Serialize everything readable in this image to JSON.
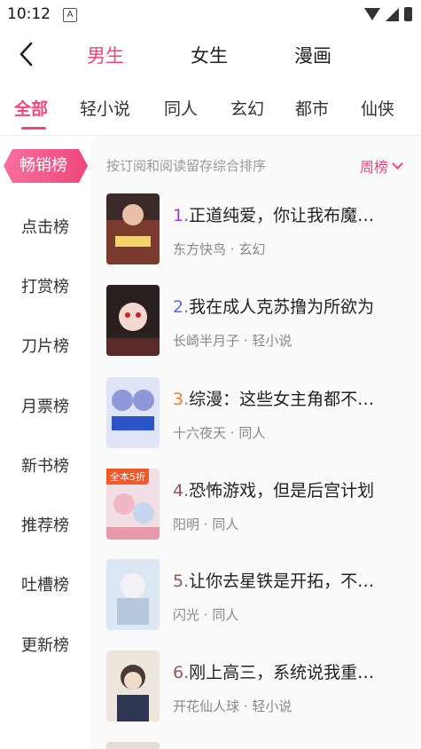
{
  "status": {
    "time": "10:12",
    "notif_icon": "A"
  },
  "header": {
    "back_icon": "back-arrow-icon",
    "tabs": [
      {
        "label": "男生",
        "active": true
      },
      {
        "label": "女生",
        "active": false
      },
      {
        "label": "漫画",
        "active": false
      }
    ]
  },
  "categories": [
    "全部",
    "轻小说",
    "同人",
    "玄幻",
    "都市",
    "仙侠"
  ],
  "sidebar": [
    "畅销榜",
    "点击榜",
    "打赏榜",
    "刀片榜",
    "月票榜",
    "新书榜",
    "推荐榜",
    "吐槽榜",
    "更新榜"
  ],
  "sort": {
    "description": "按订阅和阅读留存综合排序",
    "period": "周榜"
  },
  "books": [
    {
      "rank": "1.",
      "title": "正道纯爱，你让我布魔…",
      "author": "东方快鸟",
      "genre": "玄幻",
      "rank_color": "#9b3fd6"
    },
    {
      "rank": "2.",
      "title": "我在成人克苏撸为所欲为",
      "author": "长崎半月子",
      "genre": "轻小说",
      "rank_color": "#5b6ad8"
    },
    {
      "rank": "3.",
      "title": "综漫：这些女主角都不…",
      "author": "十六夜天",
      "genre": "同人",
      "rank_color": "#f07a28"
    },
    {
      "rank": "4.",
      "title": "恐怖游戏，但是后宫计划",
      "author": "阳明",
      "genre": "同人",
      "rank_color": "#8b5a5a",
      "badge": "全本5折"
    },
    {
      "rank": "5.",
      "title": "让你去星铁是开拓，不…",
      "author": "闪光",
      "genre": "同人",
      "rank_color": "#8b5a5a"
    },
    {
      "rank": "6.",
      "title": "刚上高三，系统说我重…",
      "author": "开花仙人球",
      "genre": "轻小说",
      "rank_color": "#8b5a5a"
    }
  ],
  "meta_separator": " · ",
  "colors": {
    "accent": "#f0467a"
  }
}
